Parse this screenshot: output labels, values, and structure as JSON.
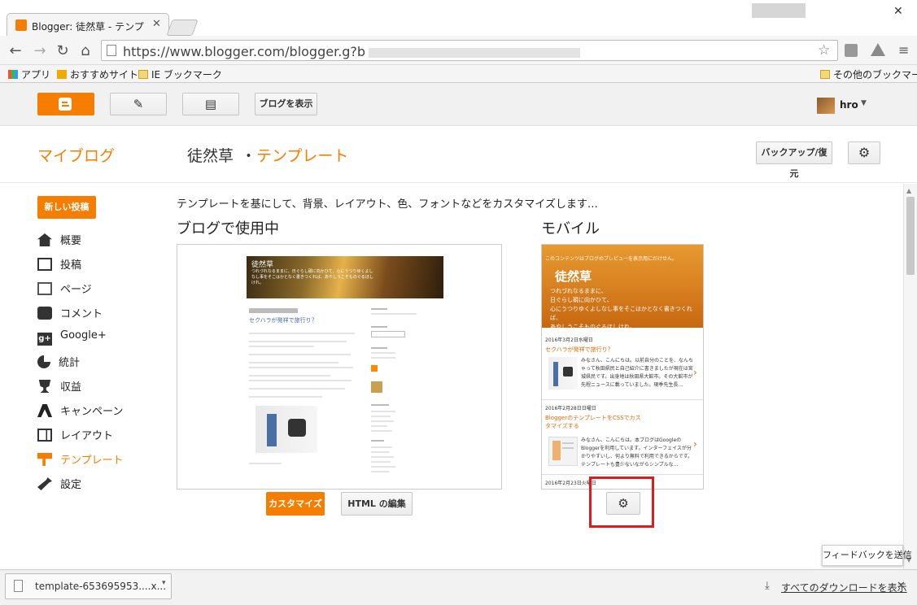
{
  "browser": {
    "tab_title": "Blogger: 徒然草 - テンプレー",
    "url_prefix": "https://www.blogger.com/blogger.g?b",
    "bookmarks": {
      "apps": "アプリ",
      "recommended": "おすすめサイト",
      "ie_bookmarks": "IE ブックマーク",
      "other": "その他のブックマーク"
    }
  },
  "header": {
    "view_blog": "ブログを表示",
    "user": "hro"
  },
  "subheader": {
    "my_blogs": "マイブログ",
    "blog_name": "徒然草",
    "separator": "・",
    "page": "テンプレート",
    "backup": "バックアップ/復元"
  },
  "sidebar": {
    "new_post": "新しい投稿",
    "items": [
      {
        "label": "概要",
        "icon": "home-icon"
      },
      {
        "label": "投稿",
        "icon": "posts-icon"
      },
      {
        "label": "ページ",
        "icon": "pages-icon"
      },
      {
        "label": "コメント",
        "icon": "comment-icon"
      },
      {
        "label": "Google+",
        "icon": "google-plus-icon"
      },
      {
        "label": "統計",
        "icon": "pie-chart-icon"
      },
      {
        "label": "収益",
        "icon": "trophy-icon"
      },
      {
        "label": "キャンペーン",
        "icon": "campaign-icon"
      },
      {
        "label": "レイアウト",
        "icon": "layout-icon"
      },
      {
        "label": "テンプレート",
        "icon": "template-icon"
      },
      {
        "label": "設定",
        "icon": "wrench-icon"
      }
    ]
  },
  "main": {
    "description": "テンプレートを基にして、背景、レイアウト、色、フォントなどをカスタマイズします…",
    "in_use_title": "ブログで使用中",
    "mobile_title": "モバイル",
    "customize": "カスタマイズ",
    "edit_html": "HTML の編集"
  },
  "desktop_preview": {
    "blog_title": "徒然草",
    "tagline": "つれづれなるままに、日ぐらし硯に向かひて、心にうつりゆくよしなし事をそこはかとなく書きつくれば、あやしうこそものぐるほしけれ。",
    "post_title": "セクハラが発祥で旅行り？"
  },
  "mobile_preview": {
    "notice": "このコンテンツはブログのプレビューを表示用にだけせん。",
    "blog_title": "徒然草",
    "tagline": "つれづれなるままに、\n日ぐらし硯に向かひて、\n心にうつりゆくよしなし事をそこはかとなく書きつくれば、\nあやしうこそものぐるほしけれ。",
    "posts": [
      {
        "date": "2016年3月2日水曜日",
        "title": "セクハラが発祥で旅行り？",
        "excerpt": "みなさん、こんにちは。以前自分のことを、なんちゃって秋田県民と自己紹介に書きましたが現在は宮城県民です。出身地は秋田県大館市。その大館市が先程ニュースに載っていました。現季先生長…"
      },
      {
        "date": "2016年2月28日日曜日",
        "title": "BloggerのテンプレートをCSSでカスタマイズする",
        "excerpt": "みなさん、こんにちは。本ブログはGoogleのBloggerを利用しています。インターフェイスが分かりやすいし、何より無料で利用できるからです。テンプレートも豊少ないながらシンプルな…"
      },
      {
        "date": "2016年2月23日火曜日",
        "title": "",
        "excerpt": ""
      }
    ]
  },
  "feedback": "フィードバックを送信",
  "downloads": {
    "file": "template-653695953....x...",
    "show_all": "すべてのダウンロードを表示"
  },
  "colors": {
    "accent": "#f57d00",
    "highlight_box": "#e01b1b"
  }
}
